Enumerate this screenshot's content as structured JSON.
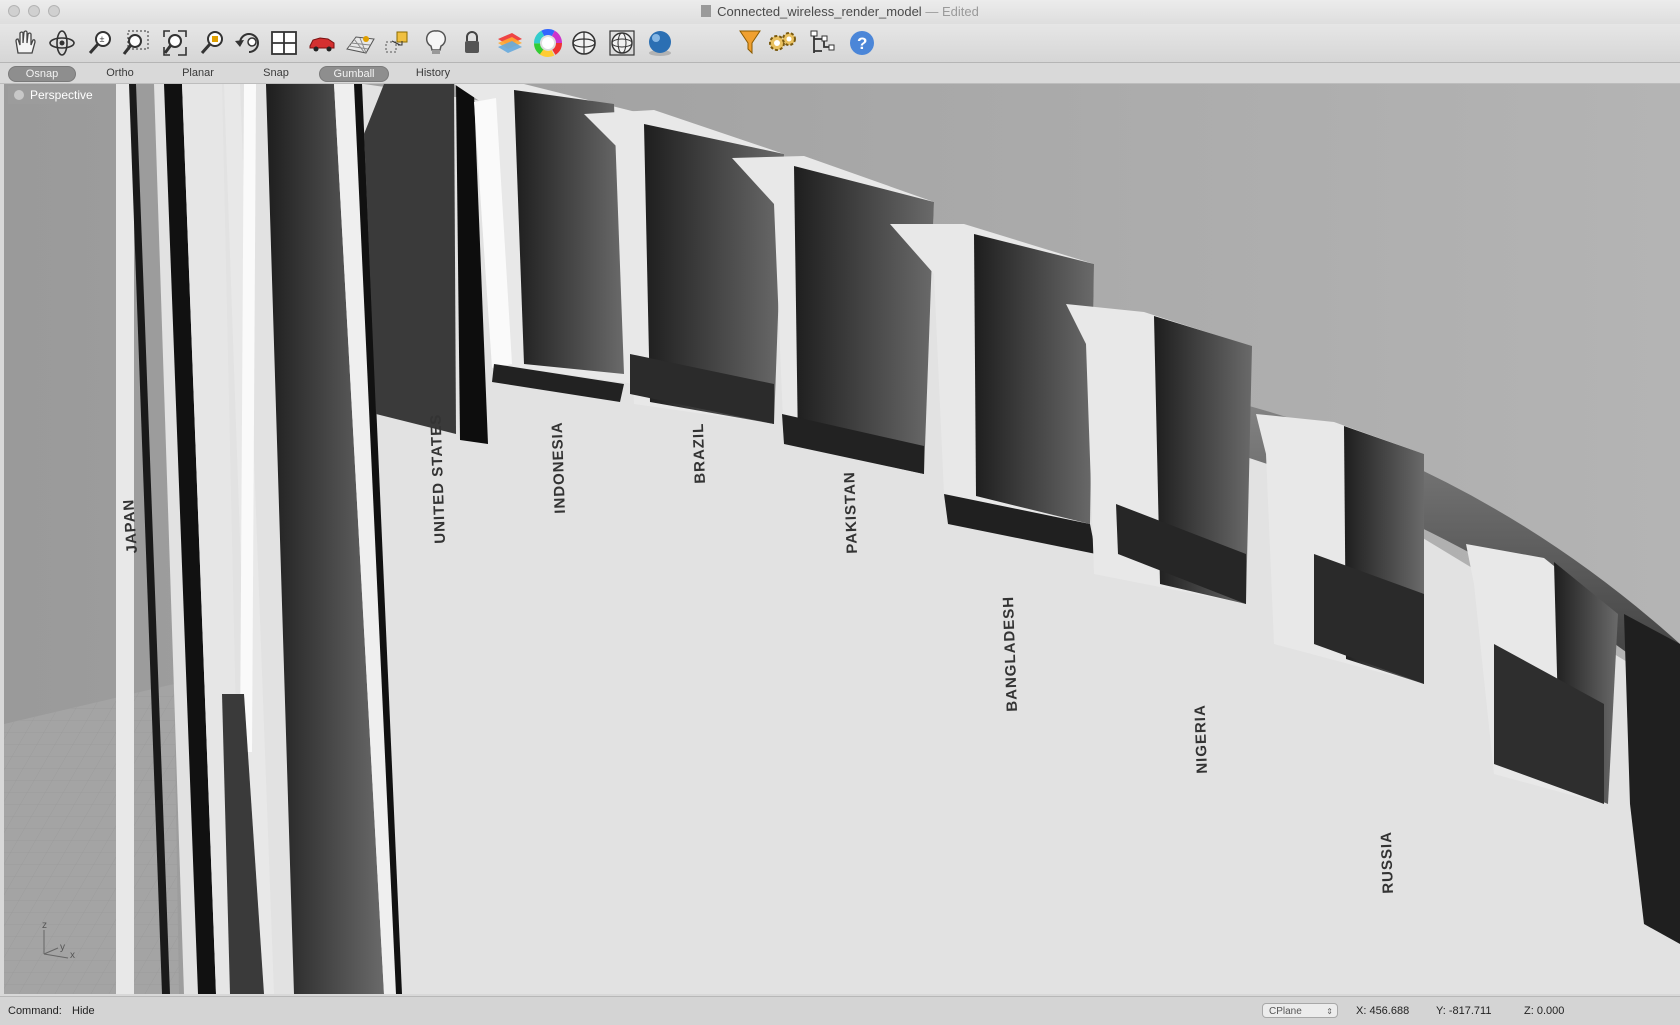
{
  "window": {
    "title": "Connected_wireless_render_model",
    "separator": "—",
    "status": "Edited"
  },
  "toolbar": {
    "tools": [
      {
        "name": "pan-icon"
      },
      {
        "name": "rotate-view-icon"
      },
      {
        "name": "zoom-icon"
      },
      {
        "name": "zoom-window-icon"
      },
      {
        "name": "zoom-extents-icon"
      },
      {
        "name": "zoom-selected-icon"
      },
      {
        "name": "undo-view-icon"
      },
      {
        "name": "viewport-layout-icon"
      },
      {
        "name": "car-object-icon"
      },
      {
        "name": "grid-plane-icon"
      },
      {
        "name": "transform-icon"
      },
      {
        "name": "light-bulb-icon"
      },
      {
        "name": "lock-icon"
      },
      {
        "name": "layers-icon"
      },
      {
        "name": "color-wheel-icon"
      },
      {
        "name": "sphere-wire-icon"
      },
      {
        "name": "mesh-sphere-icon"
      },
      {
        "name": "render-sphere-icon"
      },
      {
        "name": "selection-filter-icon"
      },
      {
        "name": "settings-gears-icon"
      },
      {
        "name": "history-tree-icon"
      },
      {
        "name": "help-icon"
      }
    ]
  },
  "modes": [
    {
      "label": "Osnap",
      "active": true
    },
    {
      "label": "Ortho",
      "active": false
    },
    {
      "label": "Planar",
      "active": false
    },
    {
      "label": "Snap",
      "active": false
    },
    {
      "label": "Gumball",
      "active": true
    },
    {
      "label": "History",
      "active": false
    }
  ],
  "viewport": {
    "label": "Perspective",
    "axis_labels": {
      "z": "z",
      "y": "y",
      "x": "x"
    },
    "countries": [
      "UNITED STATES",
      "INDONESIA",
      "BRAZIL",
      "PAKISTAN",
      "BANGLADESH",
      "NIGERIA",
      "RUSSIA"
    ],
    "country_left": "JAPAN"
  },
  "status": {
    "command_label": "Command:",
    "command_value": "Hide",
    "cplane": "CPlane",
    "x": "X: 456.688",
    "y": "Y: -817.711",
    "z": "Z: 0.000"
  },
  "colors": {
    "viewport_bg": "#a8a8a8",
    "model_light": "#e2e2e2",
    "model_dark": "#222222"
  }
}
